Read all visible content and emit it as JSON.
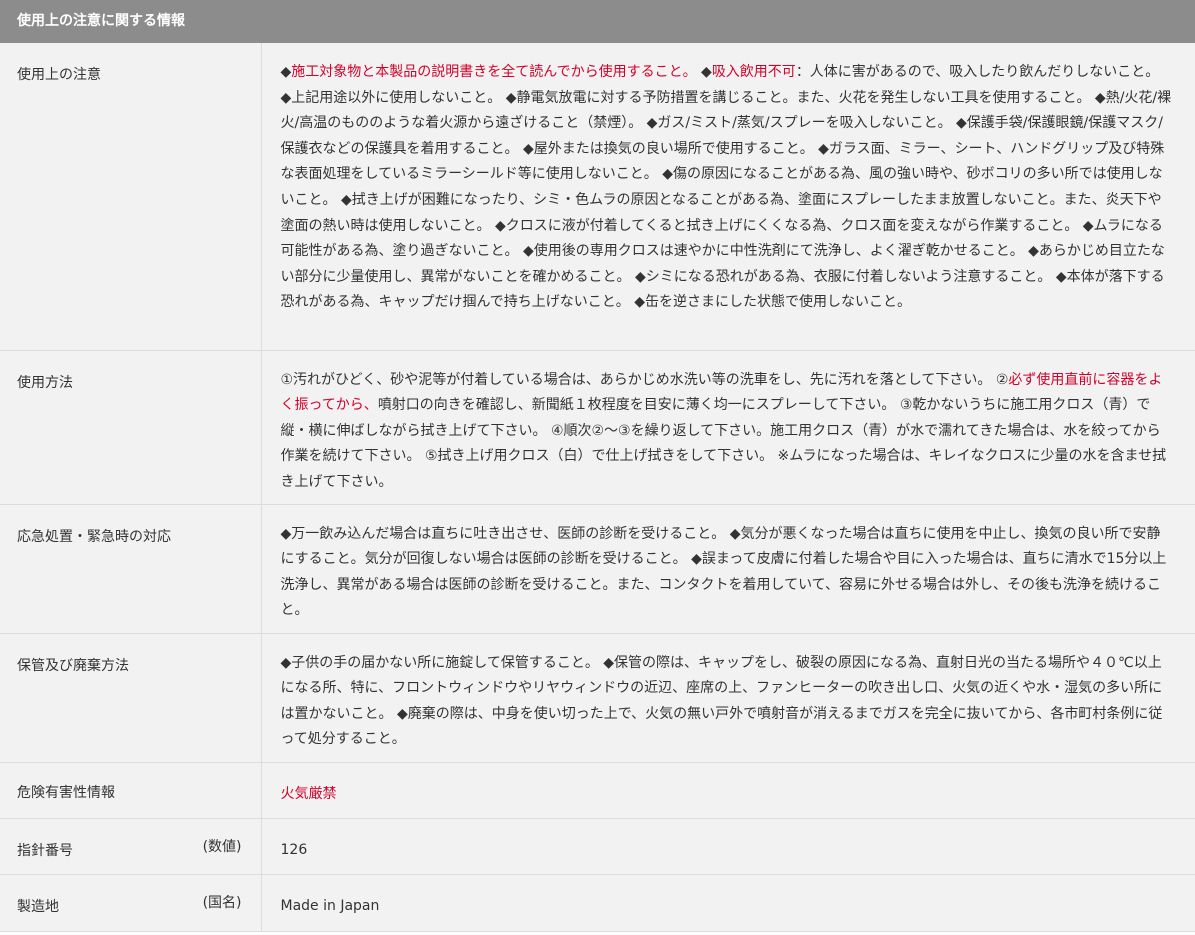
{
  "section_title": "使用上の注意に関する情報",
  "rows": {
    "caution": {
      "label": "使用上の注意",
      "t1": "◆",
      "t2": "施工対象物と本製品の説明書きを全て読んでから使用すること。",
      "t3": " ◆",
      "t4": "吸入飲用不可",
      "t5": "：人体に害があるので、吸入したり飲んだりしないこと。 ◆上記用途以外に使用しないこと。 ◆静電気放電に対する予防措置を講じること。また、火花を発生しない工具を使用すること。 ◆熱/火花/裸火/高温のもののような着火源から遠ざけること（禁煙）。 ◆ガス/ミスト/蒸気/スプレーを吸入しないこと。 ◆保護手袋/保護眼鏡/保護マスク/保護衣などの保護具を着用すること。 ◆屋外または換気の良い場所で使用すること。 ◆ガラス面、ミラー、シート、ハンドグリップ及び特殊な表面処理をしているミラーシールド等に使用しないこと。 ◆傷の原因になることがある為、風の強い時や、砂ボコリの多い所では使用しないこと。 ◆拭き上げが困難になったり、シミ・色ムラの原因となることがある為、塗面にスプレーしたまま放置しないこと。また、炎天下や塗面の熱い時は使用しないこと。 ◆クロスに液が付着してくると拭き上げにくくなる為、クロス面を変えながら作業すること。 ◆ムラになる可能性がある為、塗り過ぎないこと。 ◆使用後の専用クロスは速やかに中性洗剤にて洗浄し、よく濯ぎ乾かせること。 ◆あらかじめ目立たない部分に少量使用し、異常がないことを確かめること。 ◆シミになる恐れがある為、衣服に付着しないよう注意すること。 ◆本体が落下する恐れがある為、キャップだけ掴んで持ち上げないこと。 ◆缶を逆さまにした状態で使用しないこと。"
    },
    "usage": {
      "label": "使用方法",
      "t1": "①汚れがひどく、砂や泥等が付着している場合は、あらかじめ水洗い等の洗車をし、先に汚れを落として下さい。 ②",
      "t2": "必ず使用直前に容器をよく振ってから、",
      "t3": "噴射口の向きを確認し、新聞紙１枚程度を目安に薄く均一にスプレーして下さい。 ③乾かないうちに施工用クロス（青）で縦・横に伸ばしながら拭き上げて下さい。 ④順次②～③を繰り返して下さい。施工用クロス（青）が水で濡れてきた場合は、水を絞ってから作業を続けて下さい。 ⑤拭き上げ用クロス（白）で仕上げ拭きをして下さい。 ※ムラになった場合は、キレイなクロスに少量の水を含ませ拭き上げて下さい。"
    },
    "emergency": {
      "label": "応急処置・緊急時の対応",
      "text": "◆万一飲み込んだ場合は直ちに吐き出させ、医師の診断を受けること。 ◆気分が悪くなった場合は直ちに使用を中止し、換気の良い所で安静にすること。気分が回復しない場合は医師の診断を受けること。 ◆誤まって皮膚に付着した場合や目に入った場合は、直ちに清水で15分以上洗浄し、異常がある場合は医師の診断を受けること。また、コンタクトを着用していて、容易に外せる場合は外し、その後も洗浄を続けること。"
    },
    "storage": {
      "label": "保管及び廃棄方法",
      "text": "◆子供の手の届かない所に施錠して保管すること。 ◆保管の際は、キャップをし、破裂の原因になる為、直射日光の当たる場所や４０℃以上になる所、特に、フロントウィンドウやリヤウィンドウの近辺、座席の上、ファンヒーターの吹き出し口、火気の近くや水・湿気の多い所には置かないこと。 ◆廃棄の際は、中身を使い切った上で、火気の無い戸外で噴射音が消えるまでガスを完全に抜いてから、各市町村条例に従って処分すること。"
    },
    "hazard": {
      "label": "危険有害性情報",
      "text": "火気厳禁"
    },
    "guide_number": {
      "label": "指針番号",
      "unit": "(数値)",
      "value": "126"
    },
    "origin": {
      "label": "製造地",
      "unit": "(国名)",
      "value": "Made in Japan"
    }
  },
  "colors": {
    "header_bg": "#8c8c8c",
    "row_bg": "#f2f2f2",
    "accent_red": "#d6002a"
  }
}
